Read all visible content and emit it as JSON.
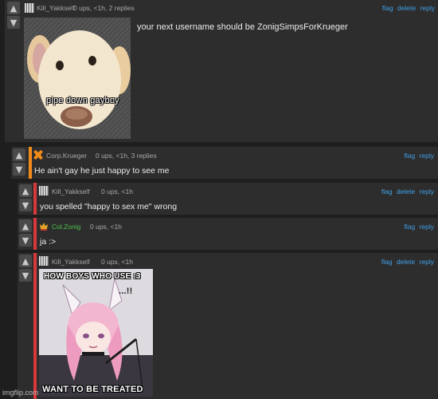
{
  "comments": [
    {
      "username": "Kill_Yakkself",
      "meta": "0 ups, <1h, 2 replies",
      "actions": [
        "flag",
        "delete",
        "reply"
      ],
      "text": "your next username should be ZonigSimpsForKrueger",
      "image_caption": "pipe down gayboy",
      "accent": "#3a3a3a"
    },
    {
      "username": "Corp.Krueger",
      "meta": "0 ups, <1h, 3 replies",
      "actions": [
        "flag",
        "reply"
      ],
      "text": "He ain't gay he just happy to see me",
      "accent": "#f08a1a"
    },
    {
      "username": "Kill_Yakkself",
      "meta": "0 ups, <1h",
      "actions": [
        "flag",
        "delete",
        "reply"
      ],
      "text": "you spelled \"happy to sex me\" wrong",
      "accent": "#d9383a"
    },
    {
      "username": "Col.Zonig",
      "meta": "0 ups, <1h",
      "actions": [
        "flag",
        "reply"
      ],
      "text": "ja :>",
      "accent": "#d9383a"
    },
    {
      "username": "Kill_Yakkself",
      "meta": "0 ups, <1h",
      "actions": [
        "flag",
        "delete",
        "reply"
      ],
      "meme_top": "HOW BOYS WHO USE :3",
      "meme_bottom": "WANT TO BE TREATED",
      "meme_sfx": "...!!",
      "accent": "#d9383a"
    }
  ],
  "watermark": "imgflip.com",
  "icons": {
    "upvote": "upvote-arrow-icon",
    "downvote": "downvote-arrow-icon"
  },
  "colors": {
    "link": "#3fa0e8",
    "orange_accent": "#f08a1a",
    "red_accent": "#d9383a",
    "username_green": "#4cc14c"
  }
}
